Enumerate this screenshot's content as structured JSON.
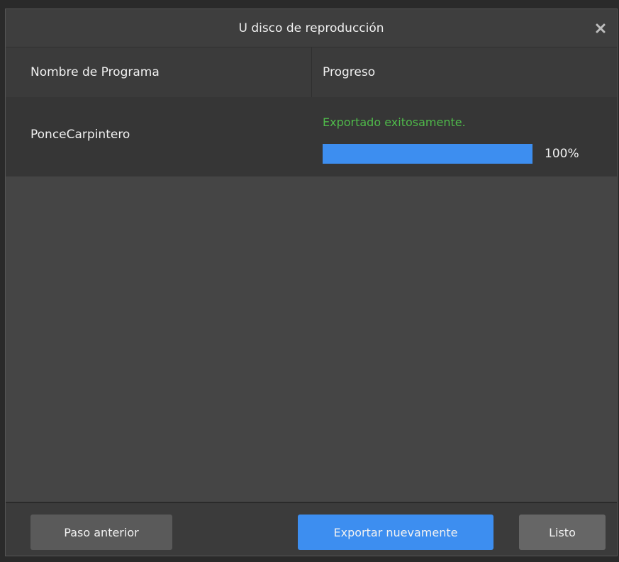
{
  "dialog": {
    "title": "U disco de reproducción",
    "close_icon": "close-icon"
  },
  "table": {
    "headers": [
      "Nombre de Programa",
      "Progreso"
    ],
    "rows": [
      {
        "name": "PonceCarpintero",
        "status": "Exportado exitosamente.",
        "progress_percent": 100,
        "progress_label": "100%"
      }
    ]
  },
  "footer": {
    "prev_label": "Paso anterior",
    "export_label": "Exportar nuevamente",
    "done_label": "Listo"
  },
  "colors": {
    "accent": "#3d8ef0",
    "success": "#4fba4a",
    "background": "#454545"
  }
}
